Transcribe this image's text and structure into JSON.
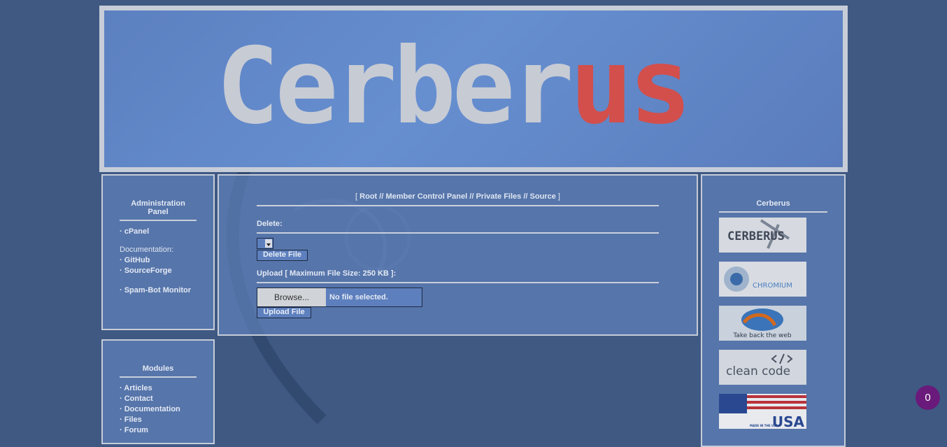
{
  "header": {
    "logo_main": "Cerber",
    "logo_accent": "us"
  },
  "left_panel": {
    "title": "Administration Panel",
    "cpanel": "· cPanel",
    "documentation_label": "Documentation:",
    "github": "· GitHub",
    "sourceforge": "· SourceForge",
    "spam_bot": "· Spam-Bot Monitor"
  },
  "modules_panel": {
    "title": "Modules",
    "items": [
      "· Articles",
      "· Contact",
      "· Documentation",
      "· Files",
      "· Forum"
    ]
  },
  "main": {
    "breadcrumb_open": "[",
    "breadcrumb_close": "]",
    "crumbs": [
      "Root",
      "Member Control Panel",
      "Private Files",
      "Source"
    ],
    "separator": "//",
    "delete_label": "Delete:",
    "delete_button": "Delete File",
    "upload_label": "Upload [ Maximum File Size: 250 KB ]:",
    "browse_button": "Browse...",
    "no_file": "No file selected.",
    "upload_button": "Upload File"
  },
  "right_panel": {
    "title": "Cerberus",
    "thumbs": [
      "CERBERUS",
      "CHROMIUM",
      "Take back the web",
      "clean code",
      "MADE IN THE USA"
    ]
  },
  "notification": {
    "count": "0"
  },
  "colors": {
    "background": "#3f5983",
    "panel_border": "#c5ccd8",
    "accent_red": "#d24f4c",
    "badge": "#6a1a7a"
  }
}
